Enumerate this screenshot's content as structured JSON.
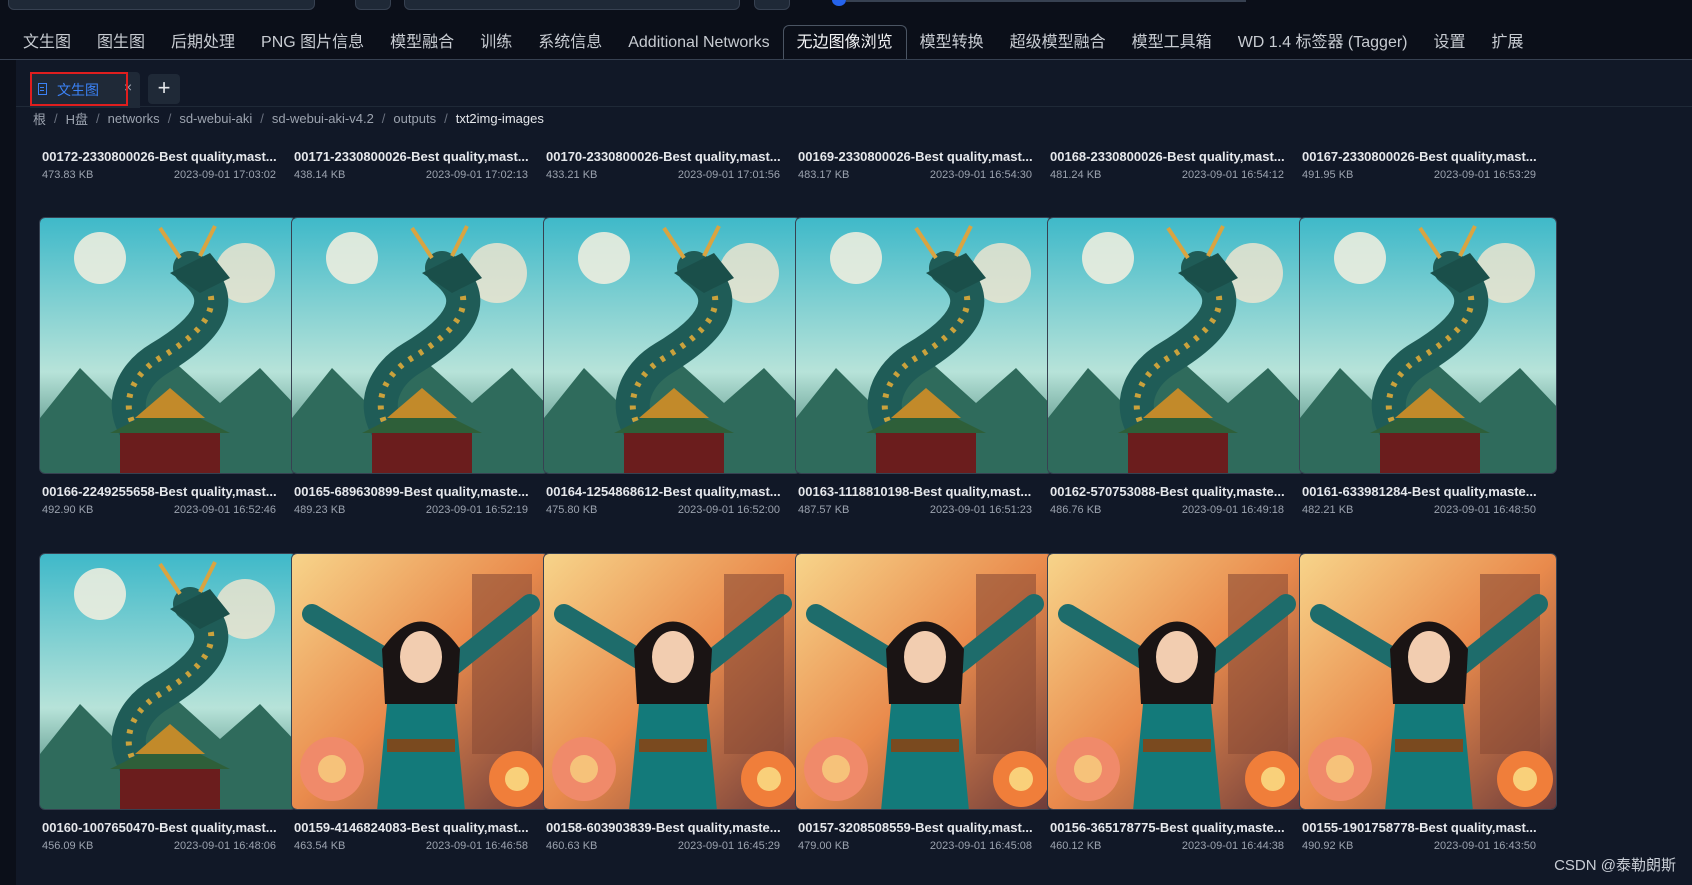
{
  "main_tabs": [
    "文生图",
    "图生图",
    "后期处理",
    "PNG 图片信息",
    "模型融合",
    "训练",
    "系统信息",
    "Additional Networks",
    "无边图像浏览",
    "模型转换",
    "超级模型融合",
    "模型工具箱",
    "WD 1.4 标签器 (Tagger)",
    "设置",
    "扩展"
  ],
  "active_main_tab": "无边图像浏览",
  "sub_tab": {
    "label": "文生图",
    "close": "×",
    "add": "+"
  },
  "breadcrumb": [
    "根",
    "H盘",
    "networks",
    "sd-webui-aki",
    "sd-webui-aki-v4.2",
    "outputs",
    "txt2img-images"
  ],
  "breadcrumb_separator": "/",
  "top_row": [
    {
      "name": "00172-2330800026-Best quality,mast...",
      "size": "473.83 KB",
      "date": "2023-09-01 17:03:02"
    },
    {
      "name": "00171-2330800026-Best quality,mast...",
      "size": "438.14 KB",
      "date": "2023-09-01 17:02:13"
    },
    {
      "name": "00170-2330800026-Best quality,mast...",
      "size": "433.21 KB",
      "date": "2023-09-01 17:01:56"
    },
    {
      "name": "00169-2330800026-Best quality,mast...",
      "size": "483.17 KB",
      "date": "2023-09-01 16:54:30"
    },
    {
      "name": "00168-2330800026-Best quality,mast...",
      "size": "481.24 KB",
      "date": "2023-09-01 16:54:12"
    },
    {
      "name": "00167-2330800026-Best quality,mast...",
      "size": "491.95 KB",
      "date": "2023-09-01 16:53:29"
    }
  ],
  "middle_row": [
    {
      "name": "00166-2249255658-Best quality,mast...",
      "size": "492.90 KB",
      "date": "2023-09-01 16:52:46",
      "image": "dragon"
    },
    {
      "name": "00165-689630899-Best quality,maste...",
      "size": "489.23 KB",
      "date": "2023-09-01 16:52:19",
      "image": "dragon"
    },
    {
      "name": "00164-1254868612-Best quality,mast...",
      "size": "475.80 KB",
      "date": "2023-09-01 16:52:00",
      "image": "dragon"
    },
    {
      "name": "00163-1118810198-Best quality,mast...",
      "size": "487.57 KB",
      "date": "2023-09-01 16:51:23",
      "image": "dragon"
    },
    {
      "name": "00162-570753088-Best quality,maste...",
      "size": "486.76 KB",
      "date": "2023-09-01 16:49:18",
      "image": "dragon"
    },
    {
      "name": "00161-633981284-Best quality,maste...",
      "size": "482.21 KB",
      "date": "2023-09-01 16:48:50",
      "image": "dragon"
    }
  ],
  "bottom_row": [
    {
      "name": "00160-1007650470-Best quality,mast...",
      "size": "456.09 KB",
      "date": "2023-09-01 16:48:06",
      "image": "dragon"
    },
    {
      "name": "00159-4146824083-Best quality,mast...",
      "size": "463.54 KB",
      "date": "2023-09-01 16:46:58",
      "image": "girl"
    },
    {
      "name": "00158-603903839-Best quality,maste...",
      "size": "460.63 KB",
      "date": "2023-09-01 16:45:29",
      "image": "girl"
    },
    {
      "name": "00157-3208508559-Best quality,mast...",
      "size": "479.00 KB",
      "date": "2023-09-01 16:45:08",
      "image": "girl"
    },
    {
      "name": "00156-365178775-Best quality,maste...",
      "size": "460.12 KB",
      "date": "2023-09-01 16:44:38",
      "image": "girl"
    },
    {
      "name": "00155-1901758778-Best quality,mast...",
      "size": "490.92 KB",
      "date": "2023-09-01 16:43:50",
      "image": "girl"
    }
  ],
  "watermark": "CSDN @泰勒朗斯",
  "colors": {
    "accent": "#3b82f6",
    "highlight_box": "#e01e1e",
    "background": "#0b0f19",
    "panel": "#111827"
  }
}
